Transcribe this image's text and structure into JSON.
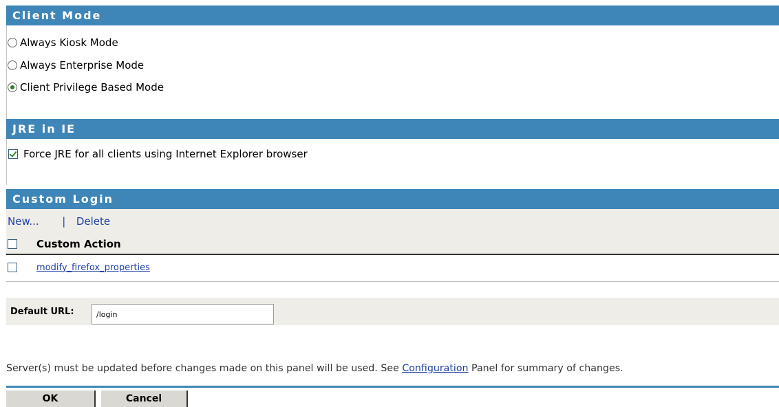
{
  "client_mode": {
    "title": "Client Mode",
    "options": [
      {
        "label": "Always Kiosk Mode",
        "checked": false
      },
      {
        "label": "Always Enterprise Mode",
        "checked": false
      },
      {
        "label": "Client Privilege Based Mode",
        "checked": true
      }
    ]
  },
  "jre_in_ie": {
    "title": "JRE in IE",
    "force_jre_label": "Force JRE for all clients using Internet Explorer browser",
    "force_jre_checked": true
  },
  "custom_login": {
    "title": "Custom Login",
    "new_label": "New...",
    "separator": "|",
    "delete_label": "Delete",
    "column_header": "Custom Action",
    "rows": [
      {
        "label": "modify_firefox_properties",
        "checked": false
      }
    ]
  },
  "default_url": {
    "label": "Default URL:",
    "value": "/login"
  },
  "notice": {
    "before": "Server(s) must be updated before changes made on this panel will be used. See ",
    "link": "Configuration",
    "after": " Panel for summary of changes."
  },
  "buttons": {
    "ok": "OK",
    "cancel": "Cancel"
  },
  "colors": {
    "header_bg": "#3f86b8",
    "link": "#1f3fa8",
    "band_bg": "#eeede8"
  }
}
